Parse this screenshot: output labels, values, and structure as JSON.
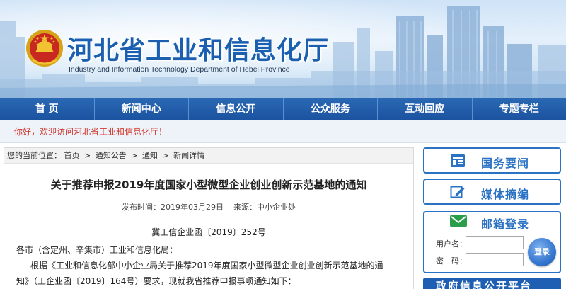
{
  "header": {
    "title": "河北省工业和信息化厅",
    "subtitle": "Industry and Information Technology Department of Hebei Province",
    "emblem_icon": "national-emblem-icon"
  },
  "nav": {
    "items": [
      {
        "label": "首 页"
      },
      {
        "label": "新闻中心"
      },
      {
        "label": "信息公开"
      },
      {
        "label": "公众服务"
      },
      {
        "label": "互动回应"
      },
      {
        "label": "专题专栏"
      }
    ]
  },
  "welcome": {
    "text": "你好，欢迎访问河北省工业和信息化厅！"
  },
  "breadcrumb": {
    "prefix": "您的当前位置：",
    "items": [
      "首页",
      "通知公告",
      "通知",
      "新闻详情"
    ],
    "separator": ">"
  },
  "article": {
    "title": "关于推荐申报2019年度国家小型微型企业创业创新示范基地的通知",
    "publish_label": "发布时间：",
    "publish_date": "2019年03月29日",
    "source_label": "来源：",
    "source": "中小企业处",
    "doc_number": "冀工信企业函〔2019〕252号",
    "addressee": "各市（含定州、辛集市）工业和信息化局：",
    "body_line1": "根据《工业和信息化部中小企业局关于推荐2019年度国家小型微型企业创业创新示范基地的通",
    "body_line2": "知》（工企业函〔2019〕164号）要求，现就我省推荐申报事项通知如下："
  },
  "sidebar": {
    "buttons": [
      {
        "label": "国务要闻",
        "icon": "news-screen-icon"
      },
      {
        "label": "媒体摘编",
        "icon": "edit-pen-icon"
      }
    ],
    "mailbox": {
      "title": "邮箱登录",
      "icon": "envelope-icon",
      "username_label": "用户名：",
      "password_label": "密　码：",
      "username_value": "",
      "password_value": "",
      "login_label": "登录"
    },
    "gov_info_label": "政府信息公开平台"
  },
  "colors": {
    "nav_blue": "#1b53a0",
    "title_blue": "#1a5fb0",
    "welcome_red": "#d0382f",
    "sidebar_blue": "#2a72c4"
  }
}
